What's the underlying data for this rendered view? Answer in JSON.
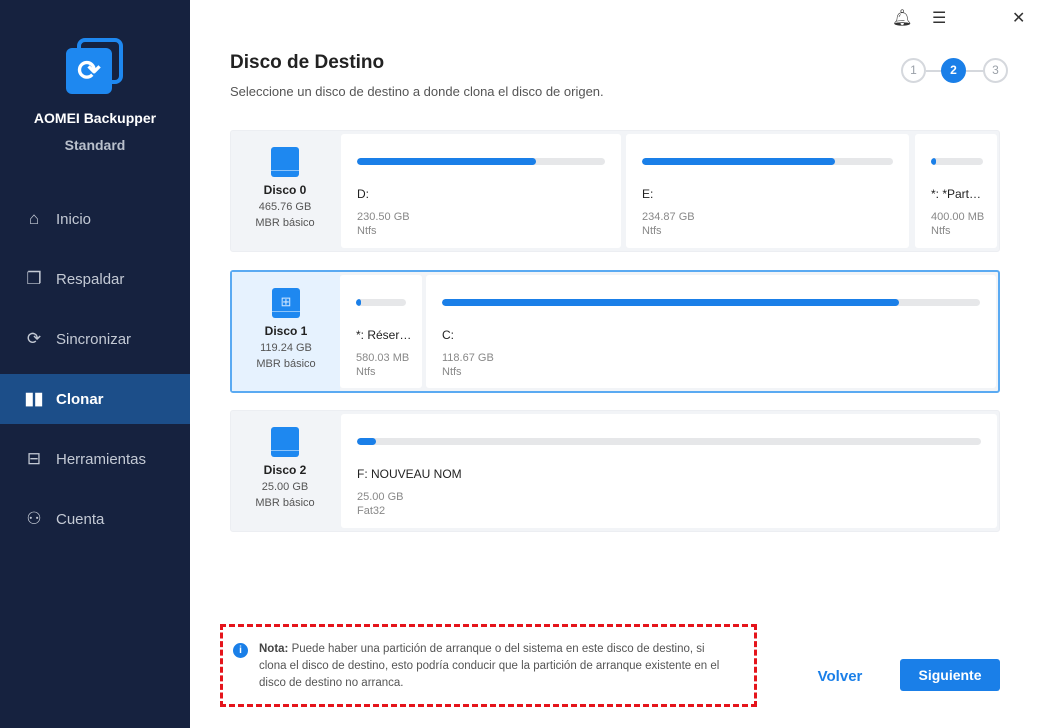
{
  "app": {
    "name": "AOMEI Backupper",
    "edition": "Standard"
  },
  "nav": [
    {
      "label": "Inicio",
      "icon": "home-icon"
    },
    {
      "label": "Respaldar",
      "icon": "backup-icon"
    },
    {
      "label": "Sincronizar",
      "icon": "sync-icon"
    },
    {
      "label": "Clonar",
      "icon": "clone-icon",
      "active": true
    },
    {
      "label": "Herramientas",
      "icon": "tools-icon"
    },
    {
      "label": "Cuenta",
      "icon": "user-icon"
    }
  ],
  "header": {
    "title": "Disco de Destino",
    "subtitle": "Seleccione un disco de destino a donde clona el disco de origen."
  },
  "steps": [
    "1",
    "2",
    "3"
  ],
  "current_step": 2,
  "disks": [
    {
      "name": "Disco 0",
      "size": "465.76 GB",
      "type": "MBR básico",
      "partitions": [
        {
          "name": "D:",
          "size": "230.50 GB",
          "fs": "Ntfs",
          "used": 0.72
        },
        {
          "name": "E:",
          "size": "234.87 GB",
          "fs": "Ntfs",
          "used": 0.77
        },
        {
          "name": "*: *Partiti...",
          "size": "400.00 MB",
          "fs": "Ntfs",
          "used": 0.06
        }
      ]
    },
    {
      "name": "Disco 1",
      "size": "119.24 GB",
      "type": "MBR básico",
      "selected": true,
      "partitions": [
        {
          "name": "*: Réservé...",
          "size": "580.03 MB",
          "fs": "Ntfs",
          "used": 0.1
        },
        {
          "name": "C:",
          "size": "118.67 GB",
          "fs": "Ntfs",
          "used": 0.85
        }
      ]
    },
    {
      "name": "Disco 2",
      "size": "25.00 GB",
      "type": "MBR básico",
      "partitions": [
        {
          "name": "F: NOUVEAU NOM",
          "size": "25.00 GB",
          "fs": "Fat32",
          "used": 0.01
        }
      ]
    }
  ],
  "note": {
    "label": "Nota:",
    "text": " Puede haber una partición de arranque o del sistema en este disco de destino, si clona el disco de destino, esto podría conducir que la partición de arranque existente en el disco de destino no arranca."
  },
  "buttons": {
    "back": "Volver",
    "next": "Siguiente"
  },
  "colors": {
    "accent": "#1a7fe8",
    "sidebar": "#16223f",
    "note_border": "#e5141b"
  }
}
